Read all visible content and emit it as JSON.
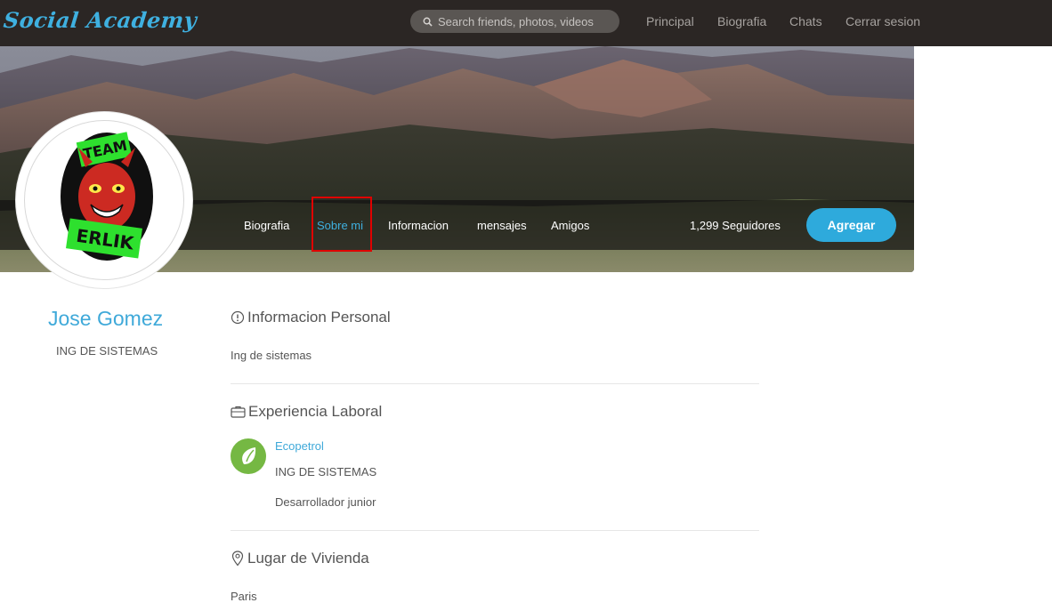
{
  "brand": "Social Academy",
  "search": {
    "placeholder": "Search friends, photos, videos"
  },
  "nav": {
    "principal": "Principal",
    "biografia": "Biografia",
    "chats": "Chats",
    "cerrar_sesion": "Cerrar sesion"
  },
  "tabs": {
    "biografia": "Biografia",
    "sobre_mi": "Sobre mi",
    "informacion": "Informacion",
    "mensajes": "mensajes",
    "amigos": "Amigos"
  },
  "followers": "1,299 Seguidores",
  "add_button": "Agregar",
  "profile": {
    "name": "Jose Gomez",
    "title": "ING DE SISTEMAS"
  },
  "personal": {
    "heading": "Informacion Personal",
    "text": "Ing de sistemas"
  },
  "work": {
    "heading": "Experiencia Laboral",
    "company": "Ecopetrol",
    "role": "ING DE SISTEMAS",
    "position": "Desarrollador junior"
  },
  "home": {
    "heading": "Lugar de Vivienda",
    "city": "Paris"
  },
  "avatar_logo_text": {
    "top": "TEAM",
    "bottom": "ERLIK"
  },
  "colors": {
    "accent": "#3fa9d9",
    "navbar": "#2b2624",
    "button": "#2eaadc",
    "highlight": "#e00000",
    "company_logo": "#75b843"
  }
}
